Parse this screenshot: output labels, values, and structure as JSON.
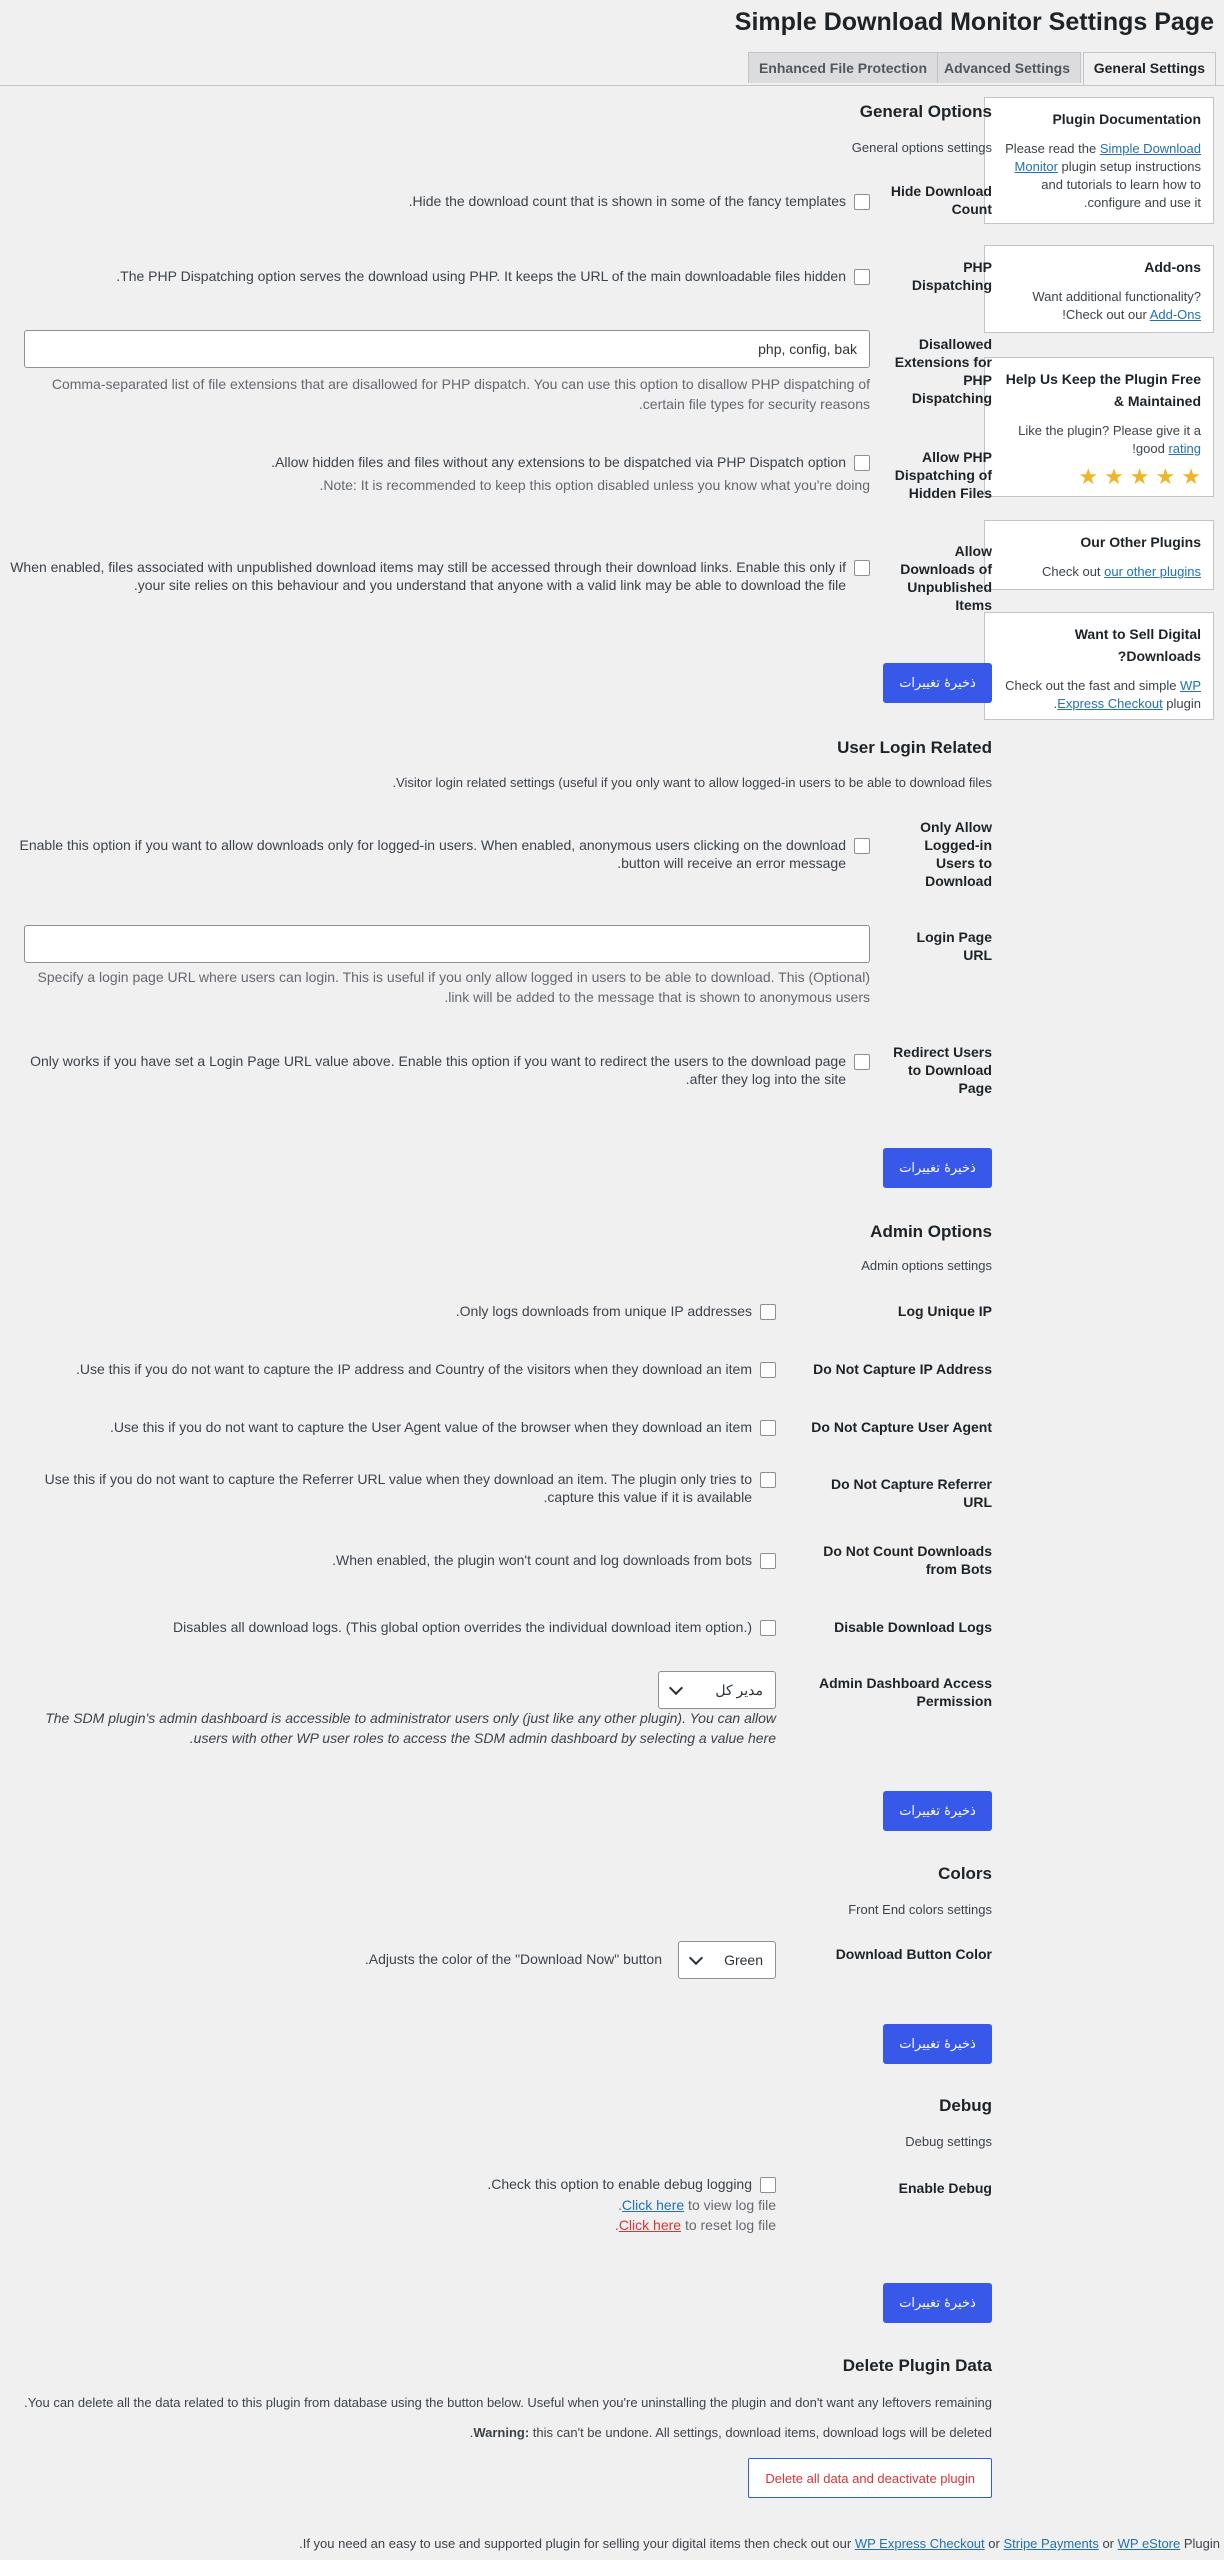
{
  "page": {
    "title": "Simple Download Monitor Settings Page"
  },
  "tabs": [
    {
      "label": "General Settings",
      "active": true
    },
    {
      "label": "Advanced Settings",
      "active": false
    },
    {
      "label": "Enhanced File Protection",
      "active": false
    }
  ],
  "sidebar": {
    "documentation": {
      "title": "Plugin Documentation",
      "text_before": "Please read the ",
      "link": "Simple Download Monitor",
      "text_after": " plugin setup instructions and tutorials to learn how to configure and use it."
    },
    "addons": {
      "title": "Add-ons",
      "text_before": "Want additional functionality? Check out our ",
      "link": "Add-Ons",
      "text_after": "!"
    },
    "keep_free": {
      "title": "Help Us Keep the Plugin Free & Maintained",
      "text_before": "Like the plugin? Please give it a good ",
      "link": "rating",
      "text_after": "!",
      "stars": [
        "★",
        "★",
        "★",
        "★",
        "★"
      ],
      "star_color": "#f0b429"
    },
    "other_plugins": {
      "title": "Our Other Plugins",
      "text_before": "Check out ",
      "link": "our other plugins"
    },
    "sell": {
      "title": "Want to Sell Digital Downloads?",
      "text_before": "Check out the fast and simple ",
      "link": "WP Express Checkout",
      "text_after": " plugin."
    }
  },
  "general": {
    "title": "General Options",
    "desc": "General options settings",
    "hide_count": {
      "label": "Hide Download Count",
      "desc": "Hide the download count that is shown in some of the fancy templates."
    },
    "php_dispatch": {
      "label": "PHP Dispatching",
      "desc": "The PHP Dispatching option serves the download using PHP. It keeps the URL of the main downloadable files hidden."
    },
    "disallowed_ext": {
      "label": "Disallowed Extensions for PHP Dispatching",
      "value": "php, config, bak",
      "desc": "Comma-separated list of file extensions that are disallowed for PHP dispatch. You can use this option to disallow PHP dispatching of certain file types for security reasons."
    },
    "hidden_files": {
      "label": "Allow PHP Dispatching of Hidden Files",
      "desc": "Allow hidden files and files without any extensions to be dispatched via PHP Dispatch option.",
      "note": "Note: It is recommended to keep this option disabled unless you know what you're doing."
    },
    "unpublished": {
      "label": "Allow Downloads of Unpublished Items",
      "desc": "When enabled, files associated with unpublished download items may still be accessed through their download links. Enable this only if your site relies on this behaviour and you understand that anyone with a valid link may be able to download the file."
    }
  },
  "save_label": "ذخیرهٔ تغییرات",
  "login": {
    "title": "User Login Related",
    "desc": "Visitor login related settings (useful if you only want to allow logged-in users to be able to download files.",
    "only_logged": {
      "label": "Only Allow Logged-in Users to Download",
      "desc": "Enable this option if you want to allow downloads only for logged-in users. When enabled, anonymous users clicking on the download button will receive an error message."
    },
    "login_url": {
      "label": "Login Page URL",
      "value": "",
      "desc": "(Optional) Specify a login page URL where users can login. This is useful if you only allow logged in users to be able to download. This link will be added to the message that is shown to anonymous users."
    },
    "redirect": {
      "label": "Redirect Users to Download Page",
      "desc": "Only works if you have set a Login Page URL value above. Enable this option if you want to redirect the users to the download page after they log into the site."
    }
  },
  "admin": {
    "title": "Admin Options",
    "desc": "Admin options settings",
    "unique_ip": {
      "label": "Log Unique IP",
      "desc": "Only logs downloads from unique IP addresses."
    },
    "no_ip": {
      "label": "Do Not Capture IP Address",
      "desc": "Use this if you do not want to capture the IP address and Country of the visitors when they download an item."
    },
    "no_ua": {
      "label": "Do Not Capture User Agent",
      "desc": "Use this if you do not want to capture the User Agent value of the browser when they download an item."
    },
    "no_ref": {
      "label": "Do Not Capture Referrer URL",
      "desc": "Use this if you do not want to capture the Referrer URL value when they download an item. The plugin only tries to capture this value if it is available."
    },
    "no_bots": {
      "label": "Do Not Count Downloads from Bots",
      "desc": "When enabled, the plugin won't count and log downloads from bots."
    },
    "disable_logs": {
      "label": "Disable Download Logs",
      "desc": "Disables all download logs. (This global option overrides the individual download item option.)"
    },
    "dashboard": {
      "label": "Admin Dashboard Access Permission",
      "selected": "مدیر کل",
      "desc": "The SDM plugin's admin dashboard is accessible to administrator users only (just like any other plugin). You can allow users with other WP user roles to access the SDM admin dashboard by selecting a value here."
    }
  },
  "colors": {
    "title": "Colors",
    "desc": "Front End colors settings",
    "button_color": {
      "label": "Download Button Color",
      "selected": "Green",
      "desc": "Adjusts the color of the \"Download Now\" button."
    }
  },
  "debug": {
    "title": "Debug",
    "desc": "Debug settings",
    "enable": {
      "label": "Enable Debug",
      "desc": "Check this option to enable debug logging.",
      "view_link": "Click here",
      "view_text": " to view log file.",
      "reset_link": "Click here",
      "reset_text": " to reset log file."
    }
  },
  "delete": {
    "title": "Delete Plugin Data",
    "desc": "You can delete all the data related to this plugin from database using the button below. Useful when you're uninstalling the plugin and don't want any leftovers remaining.",
    "warning_label": "Warning:",
    "warning_text": " this can't be undone. All settings, download items, download logs will be deleted.",
    "button": "Delete all data and deactivate plugin"
  },
  "footer": {
    "text_before": "If you need an easy to use and supported plugin for selling your digital items then check out our ",
    "link1": "WP Express Checkout",
    "or1": " or ",
    "link2": "Stripe Payments",
    "or2": " or ",
    "link3": "WP eStore",
    "text_after": " Plugin."
  }
}
